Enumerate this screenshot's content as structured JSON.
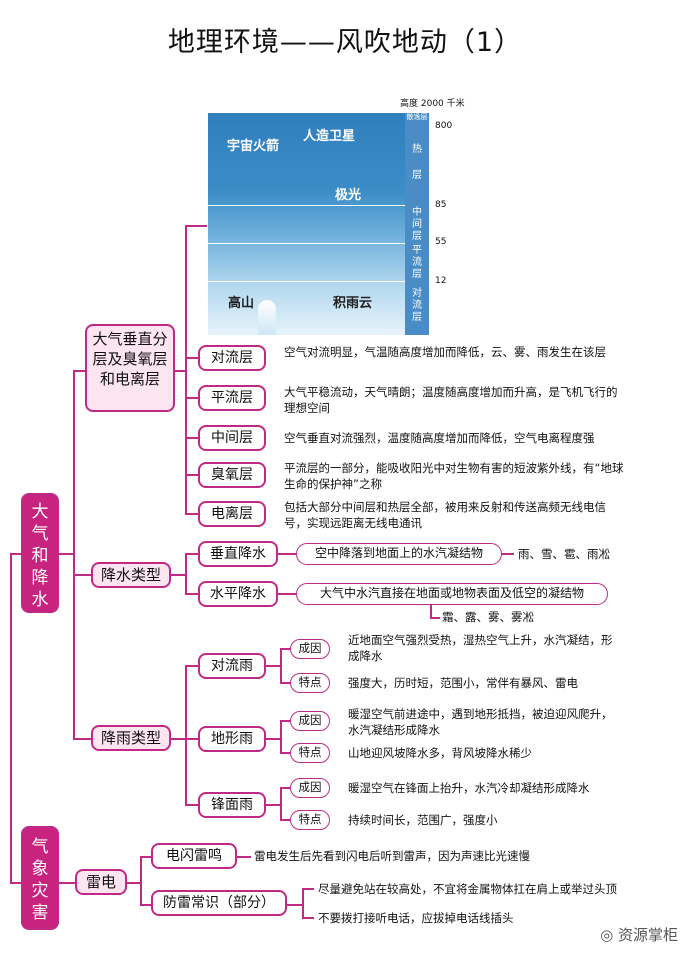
{
  "title": "地理环境——风吹地动（1）",
  "atmosphere": {
    "altitude_label": "高度 2000 千米",
    "labels": {
      "rocket": "宇宙火箭",
      "satellite": "人造卫星",
      "aurora": "极光",
      "mountain": "高山",
      "cloud": "积雨云"
    },
    "layers": {
      "exosphere": "散逸层",
      "thermo": "热\n层",
      "meso": "中\n间\n层",
      "strato": "平\n流\n层",
      "tropo": "对\n流\n层"
    },
    "altitudes": [
      "800",
      "85",
      "55",
      "12"
    ]
  },
  "root1": "大\n气\n和\n降\n水",
  "root2": "气\n象\n灾\n害",
  "section1": {
    "title": "大气垂直分层及臭氧层和电离层",
    "items": [
      {
        "label": "对流层",
        "desc": "空气对流明显，气温随高度增加而降低，云、雾、雨发生在该层"
      },
      {
        "label": "平流层",
        "desc": "大气平稳流动，天气晴朗；温度随高度增加而升高，是飞机飞行的理想空间"
      },
      {
        "label": "中间层",
        "desc": "空气垂直对流强烈，温度随高度增加而降低，空气电离程度强"
      },
      {
        "label": "臭氧层",
        "desc": "平流层的一部分，能吸收阳光中对生物有害的短波紫外线，有“地球生命的保护神”之称"
      },
      {
        "label": "电离层",
        "desc": "包括大部分中间层和热层全部，被用来反射和传送高频无线电信号，实现远距离无线电通讯"
      }
    ]
  },
  "section2": {
    "title": "降水类型",
    "vertical": {
      "label": "垂直降水",
      "def": "空中降落到地面上的水汽凝结物",
      "examples": "雨、雪、雹、雨凇"
    },
    "horizontal": {
      "label": "水平降水",
      "def": "大气中水汽直接在地面或地物表面及低空的凝结物",
      "examples": "霜、露、雾、雾凇"
    }
  },
  "section3": {
    "title": "降雨类型",
    "cause_label": "成因",
    "feature_label": "特点",
    "types": [
      {
        "label": "对流雨",
        "cause": "近地面空气强烈受热，湿热空气上升，水汽凝结，形成降水",
        "feature": "强度大，历时短，范围小，常伴有暴风、雷电"
      },
      {
        "label": "地形雨",
        "cause": "暖湿空气前进途中，遇到地形抵挡，被迫迎风爬升，水汽凝结形成降水",
        "feature": "山地迎风坡降水多，背风坡降水稀少"
      },
      {
        "label": "锋面雨",
        "cause": "暖湿空气在锋面上抬升，水汽冷却凝结形成降水",
        "feature": "持续时间长，范围广，强度小"
      }
    ]
  },
  "section4": {
    "title": "雷电",
    "flash": {
      "label": "电闪雷鸣",
      "desc": "雷电发生后先看到闪电后听到雷声，因为声速比光速慢"
    },
    "safety": {
      "label": "防雷常识（部分）",
      "tips": [
        "尽量避免站在较高处，不宜将金属物体扛在肩上或举过头顶",
        "不要拨打接听电话，应拔掉电话线插头"
      ]
    }
  },
  "watermark": "资源掌柜"
}
